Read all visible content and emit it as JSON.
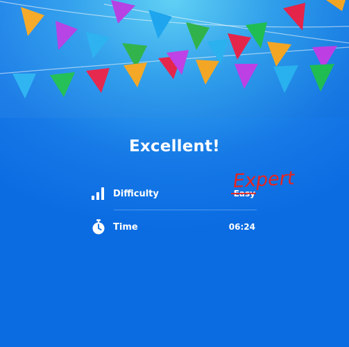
{
  "result": {
    "title": "Excellent!"
  },
  "stats": {
    "difficulty": {
      "label": "Difficulty",
      "value": "Easy",
      "icon": "signal-bars-icon"
    },
    "time": {
      "label": "Time",
      "value": "06:24",
      "icon": "stopwatch-icon"
    }
  },
  "annotation": {
    "text": "Expert",
    "color": "#e8241e"
  },
  "colors": {
    "background_top": "#5fd3f8",
    "background_bottom": "#0b6ce2",
    "text": "#ffffff"
  }
}
